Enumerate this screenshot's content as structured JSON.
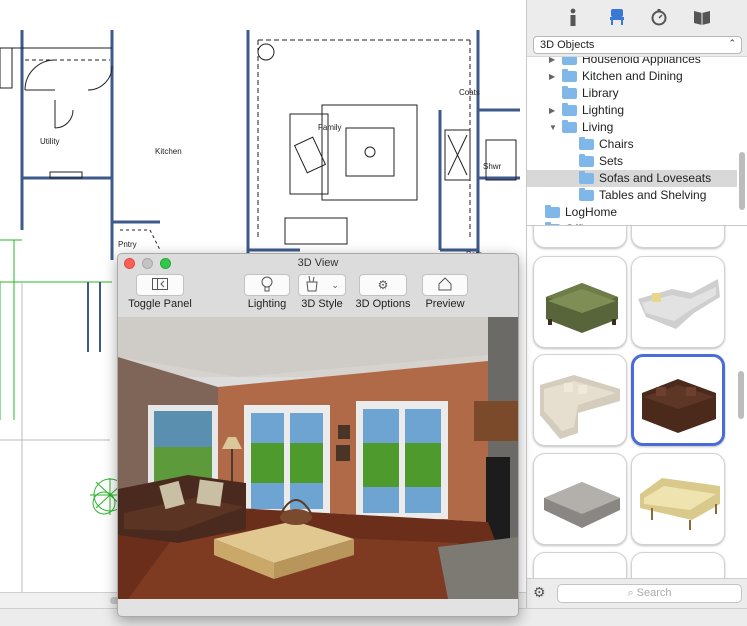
{
  "tabs": [
    {
      "name": "info-icon",
      "glyph": "ℹ"
    },
    {
      "name": "furniture-icon",
      "glyph": "🪑"
    },
    {
      "name": "stopwatch-icon",
      "glyph": "⏱"
    },
    {
      "name": "book-icon",
      "glyph": "📖"
    }
  ],
  "category_select": "3D Objects",
  "tree": [
    {
      "label": "Household Appliances",
      "level": 1,
      "arrow": "▶"
    },
    {
      "label": "Kitchen and Dining",
      "level": 1,
      "arrow": "▶"
    },
    {
      "label": "Library",
      "level": 1,
      "arrow": ""
    },
    {
      "label": "Lighting",
      "level": 1,
      "arrow": "▶"
    },
    {
      "label": "Living",
      "level": 1,
      "arrow": "▼"
    },
    {
      "label": "Chairs",
      "level": 2,
      "arrow": ""
    },
    {
      "label": "Sets",
      "level": 2,
      "arrow": ""
    },
    {
      "label": "Sofas and Loveseats",
      "level": 2,
      "arrow": "",
      "selected": true
    },
    {
      "label": "Tables and Shelving",
      "level": 2,
      "arrow": ""
    },
    {
      "label": "LogHome",
      "level": 0,
      "arrow": ""
    },
    {
      "label": "Office",
      "level": 0,
      "arrow": "▶"
    }
  ],
  "search_placeholder": "Search",
  "window": {
    "title": "3D View",
    "toolbar": {
      "toggle_panel": "Toggle Panel",
      "lighting": "Lighting",
      "style": "3D Style",
      "options": "3D Options",
      "preview": "Preview"
    }
  },
  "plan_labels": {
    "utility": "Utility",
    "kitchen": "Kitchen",
    "family": "Family",
    "coats": "Coats",
    "shwr": "Shwr",
    "pntry": "Pntry",
    "bath": "Bath"
  },
  "colors": {
    "selection": "#4a6bd8",
    "wall": "#4a5f8a",
    "folder": "#7fb7e8"
  }
}
